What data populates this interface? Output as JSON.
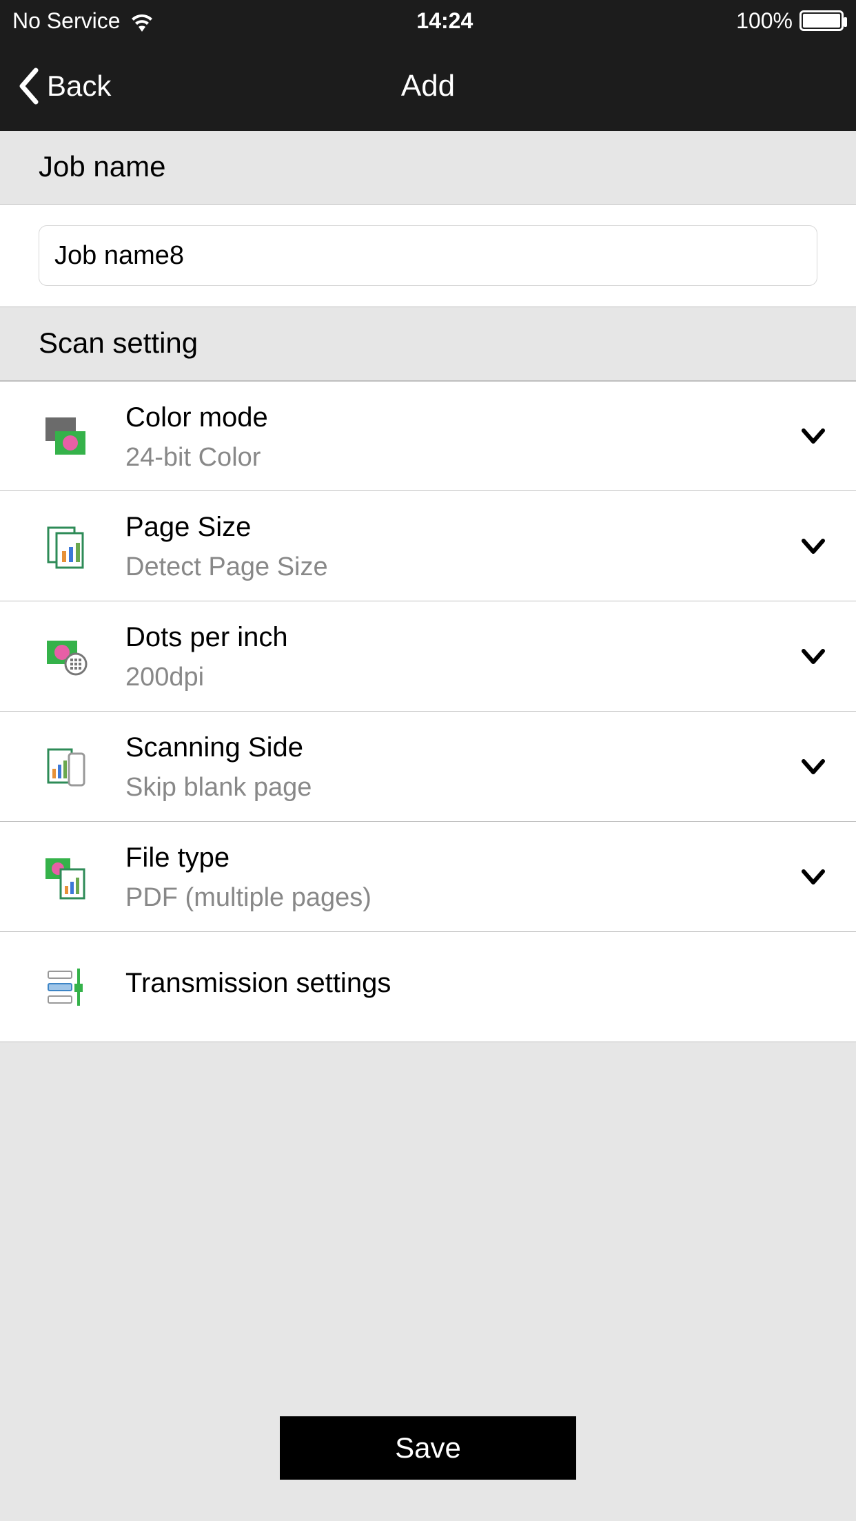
{
  "status": {
    "carrier": "No Service",
    "time": "14:24",
    "battery": "100%"
  },
  "nav": {
    "back_label": "Back",
    "title": "Add"
  },
  "sections": {
    "job_name_header": "Job name",
    "scan_setting_header": "Scan setting"
  },
  "job_name_input": {
    "value": "Job name8"
  },
  "settings": [
    {
      "label": "Color mode",
      "value": "24-bit Color",
      "chevron": true
    },
    {
      "label": "Page Size",
      "value": "Detect Page Size",
      "chevron": true
    },
    {
      "label": "Dots per inch",
      "value": "200dpi",
      "chevron": true
    },
    {
      "label": "Scanning Side",
      "value": "Skip blank page",
      "chevron": true
    },
    {
      "label": "File type",
      "value": "PDF (multiple pages)",
      "chevron": true
    },
    {
      "label": "Transmission settings",
      "value": "",
      "chevron": false
    }
  ],
  "footer": {
    "save_label": "Save"
  }
}
